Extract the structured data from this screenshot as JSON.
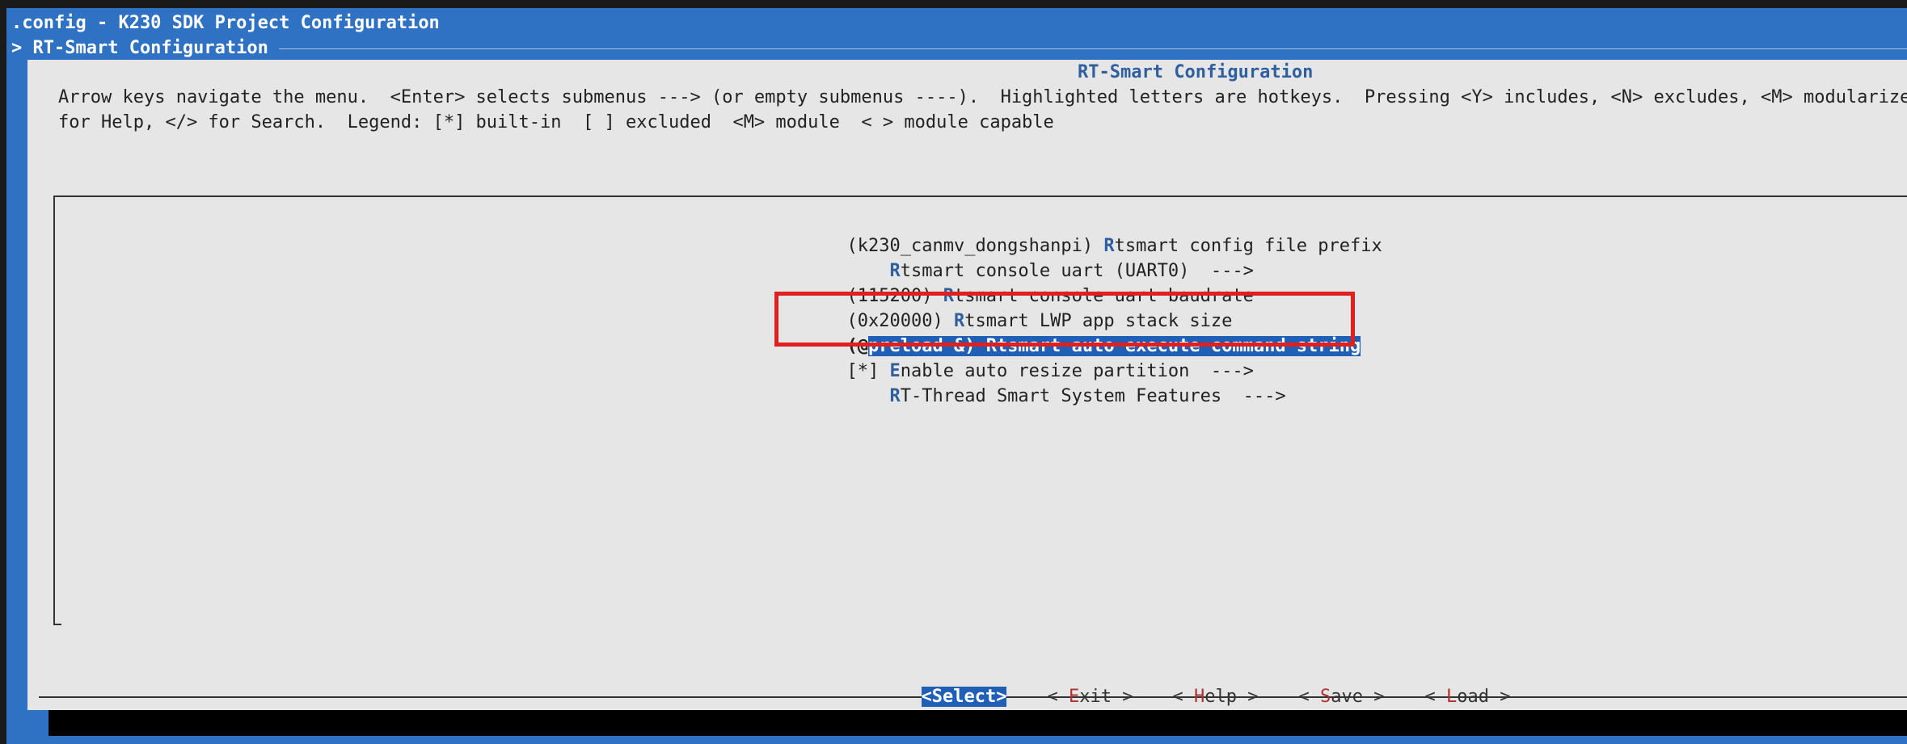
{
  "window": {
    "title": ".config - K230 SDK Project Configuration",
    "breadcrumb": "> RT-Smart Configuration"
  },
  "dialog": {
    "title": "RT-Smart Configuration",
    "help_line1": "Arrow keys navigate the menu.  <Enter> selects submenus ---> (or empty submenus ----).  Highlighted letters are hotkeys.  Pressing <Y> includes, <N> excludes, <M> modularizes f",
    "help_line2": "for Help, </> for Search.  Legend: [*] built-in  [ ] excluded  <M> module  < > module capable"
  },
  "menu": {
    "items": [
      {
        "prefix": "(k230_canmv_dongshanpi) ",
        "hotkey": "R",
        "rest": "tsmart config file prefix"
      },
      {
        "prefix": "    ",
        "hotkey": "R",
        "rest": "tsmart console uart (UART0)  --->"
      },
      {
        "prefix": "(115200) ",
        "hotkey": "R",
        "rest": "tsmart console uart baudrate"
      },
      {
        "prefix": "(0x20000) ",
        "hotkey": "R",
        "rest": "tsmart LWP app stack size"
      },
      {
        "prefix_cursor": "(@",
        "text": "preload &) Rtsmart auto execute command string"
      },
      {
        "prefix": "[*] ",
        "hotkey": "E",
        "rest": "nable auto resize partition  --->"
      },
      {
        "prefix": "    ",
        "hotkey": "R",
        "rest": "T-Thread Smart System Features  --->"
      }
    ]
  },
  "buttons": {
    "select": "<Select>",
    "exit": {
      "pre": "< ",
      "hotkey": "E",
      "rest": "xit >"
    },
    "help": {
      "pre": "< ",
      "hotkey": "H",
      "rest": "elp >"
    },
    "save": {
      "pre": "< ",
      "hotkey": "S",
      "rest": "ave >"
    },
    "load": {
      "pre": "< ",
      "hotkey": "L",
      "rest": "oad >"
    }
  },
  "colors": {
    "terminal_blue": "#2f72c4",
    "dialog_gray": "#e6e6e6",
    "highlight": "#1f5fb5",
    "annotation_red": "#e02020"
  }
}
